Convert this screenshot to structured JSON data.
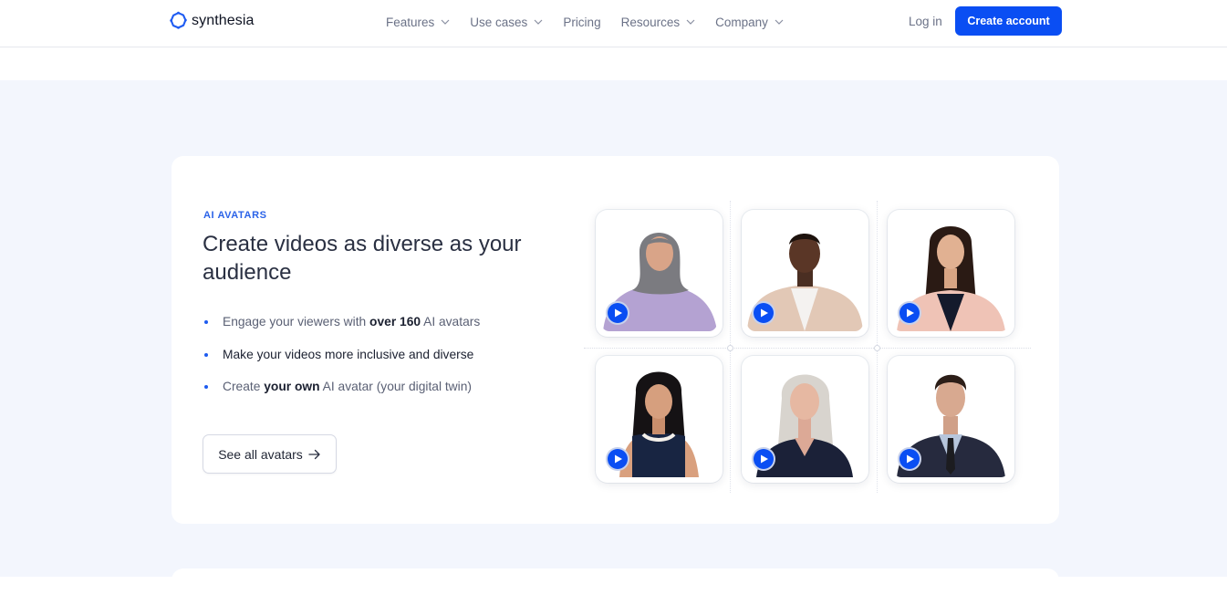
{
  "header": {
    "logo_text": "synthesia",
    "nav": [
      {
        "label": "Features",
        "has_dropdown": true
      },
      {
        "label": "Use cases",
        "has_dropdown": true
      },
      {
        "label": "Pricing",
        "has_dropdown": false
      },
      {
        "label": "Resources",
        "has_dropdown": true
      },
      {
        "label": "Company",
        "has_dropdown": true
      }
    ],
    "login_label": "Log in",
    "cta_label": "Create account"
  },
  "colors": {
    "brand_blue": "#0a4ef3",
    "eyebrow_blue": "#2a62e8",
    "section_bg": "#f3f6fd"
  },
  "section": {
    "eyebrow": "AI AVATARS",
    "headline": "Create videos as diverse as your audience",
    "bullets": [
      {
        "before": "Engage your viewers with ",
        "bold": "over 160",
        "after": " AI avatars"
      },
      {
        "before": "",
        "bold": "",
        "after": "Make your videos more inclusive and diverse"
      },
      {
        "before": "Create ",
        "bold": "your own",
        "after": " AI avatar (your digital twin)"
      }
    ],
    "see_all_label": "See all avatars",
    "see_all_icon": "arrow-right-icon"
  },
  "avatars": [
    {
      "name": "avatar-hijab-woman",
      "play_icon": "play-icon"
    },
    {
      "name": "avatar-man-beige-shirt",
      "play_icon": "play-icon"
    },
    {
      "name": "avatar-woman-pink-blazer",
      "play_icon": "play-icon"
    },
    {
      "name": "avatar-woman-navy-top",
      "play_icon": "play-icon"
    },
    {
      "name": "avatar-older-woman",
      "play_icon": "play-icon"
    },
    {
      "name": "avatar-man-suit",
      "play_icon": "play-icon"
    }
  ]
}
